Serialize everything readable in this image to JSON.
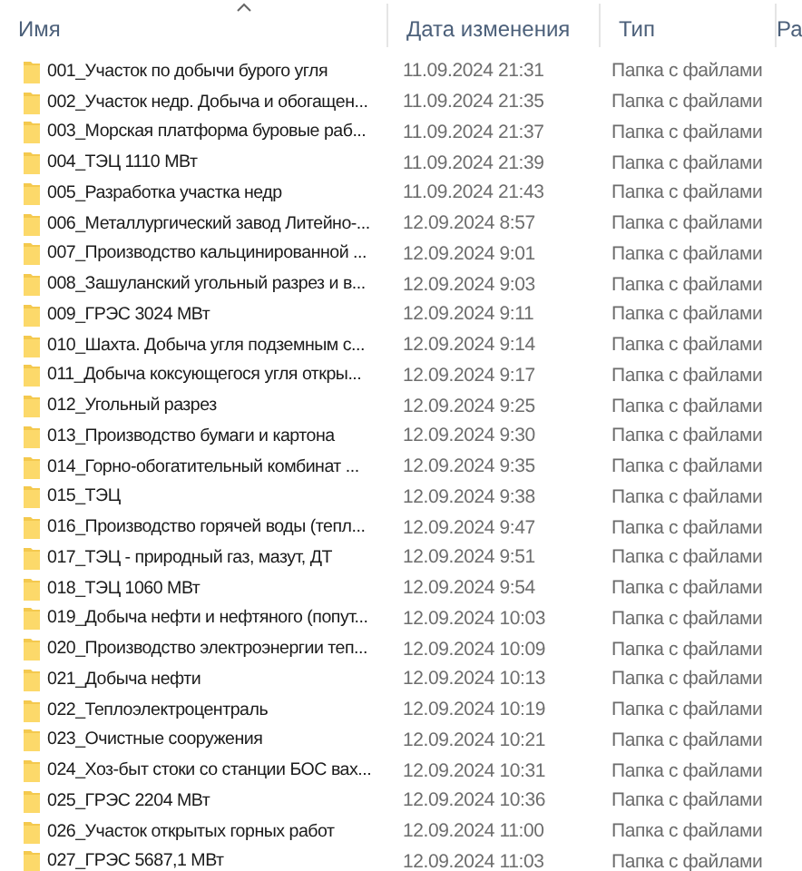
{
  "columns": [
    {
      "label": "Имя",
      "sorted": true
    },
    {
      "label": "Дата изменения",
      "sorted": false
    },
    {
      "label": "Тип",
      "sorted": false
    },
    {
      "label": "Ра",
      "sorted": false
    }
  ],
  "rows": [
    {
      "name": "001_Участок по добычи бурого угля",
      "date": "11.09.2024 21:31",
      "type": "Папка с файлами"
    },
    {
      "name": "002_Участок недр. Добыча и обогащен...",
      "date": "11.09.2024 21:35",
      "type": "Папка с файлами"
    },
    {
      "name": "003_Морская платформа буровые раб...",
      "date": "11.09.2024 21:37",
      "type": "Папка с файлами"
    },
    {
      "name": "004_ТЭЦ 1110 МВт",
      "date": "11.09.2024 21:39",
      "type": "Папка с файлами"
    },
    {
      "name": "005_Разработка участка недр",
      "date": "11.09.2024 21:43",
      "type": "Папка с файлами"
    },
    {
      "name": "006_Металлургический завод Литейно-...",
      "date": "12.09.2024 8:57",
      "type": "Папка с файлами"
    },
    {
      "name": "007_Производство кальцинированной ...",
      "date": "12.09.2024 9:01",
      "type": "Папка с файлами"
    },
    {
      "name": "008_Зашуланский угольный разрез и в...",
      "date": "12.09.2024 9:03",
      "type": "Папка с файлами"
    },
    {
      "name": "009_ГРЭС  3024 МВт",
      "date": "12.09.2024 9:11",
      "type": "Папка с файлами"
    },
    {
      "name": "010_Шахта. Добыча угля подземным с...",
      "date": "12.09.2024 9:14",
      "type": "Папка с файлами"
    },
    {
      "name": "011_Добыча коксующегося угля откры...",
      "date": "12.09.2024 9:17",
      "type": "Папка с файлами"
    },
    {
      "name": "012_Угольный разрез",
      "date": "12.09.2024 9:25",
      "type": "Папка с файлами"
    },
    {
      "name": "013_Производство бумаги и картона",
      "date": "12.09.2024 9:30",
      "type": "Папка с файлами"
    },
    {
      "name": "014_Горно-обогатительный комбинат ...",
      "date": "12.09.2024 9:35",
      "type": "Папка с файлами"
    },
    {
      "name": "015_ТЭЦ",
      "date": "12.09.2024 9:38",
      "type": "Папка с файлами"
    },
    {
      "name": "016_Производство горячей воды (тепл...",
      "date": "12.09.2024 9:47",
      "type": "Папка с файлами"
    },
    {
      "name": "017_ТЭЦ - природный газ, мазут, ДТ",
      "date": "12.09.2024 9:51",
      "type": "Папка с файлами"
    },
    {
      "name": "018_ТЭЦ 1060 МВт",
      "date": "12.09.2024 9:54",
      "type": "Папка с файлами"
    },
    {
      "name": "019_Добыча нефти и нефтяного (попут...",
      "date": "12.09.2024 10:03",
      "type": "Папка с файлами"
    },
    {
      "name": "020_Производство электроэнергии теп...",
      "date": "12.09.2024 10:09",
      "type": "Папка с файлами"
    },
    {
      "name": "021_Добыча нефти",
      "date": "12.09.2024 10:13",
      "type": "Папка с файлами"
    },
    {
      "name": "022_Теплоэлектроцентраль",
      "date": "12.09.2024 10:19",
      "type": "Папка с файлами"
    },
    {
      "name": "023_Очистные сооружения",
      "date": "12.09.2024 10:21",
      "type": "Папка с файлами"
    },
    {
      "name": "024_Хоз-быт стоки со станции БОС вах...",
      "date": "12.09.2024 10:31",
      "type": "Папка с файлами"
    },
    {
      "name": "025_ГРЭС 2204 МВт",
      "date": "12.09.2024 10:36",
      "type": "Папка с файлами"
    },
    {
      "name": "026_Участок открытых горных работ",
      "date": "12.09.2024 11:00",
      "type": "Папка с файлами"
    },
    {
      "name": "027_ГРЭС 5687,1 МВт",
      "date": "12.09.2024 11:03",
      "type": "Папка с файлами"
    }
  ]
}
